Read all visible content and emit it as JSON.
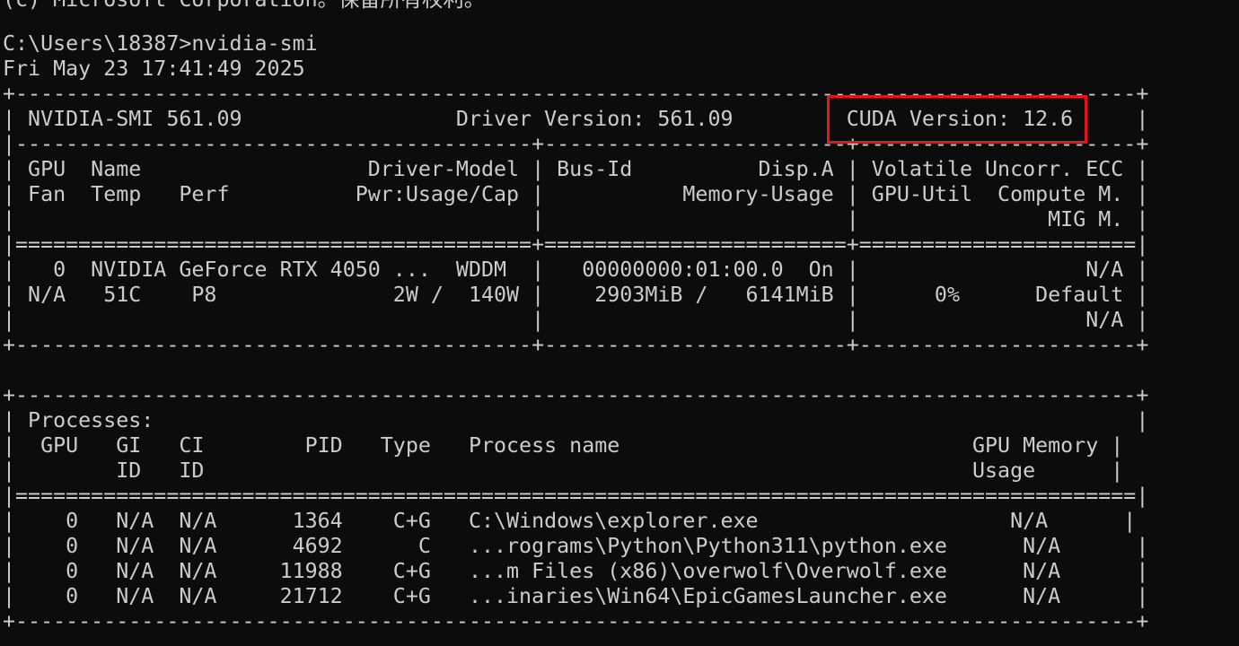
{
  "terminal": {
    "copyright_line": "(c) Microsoft Corporation。保留所有权利。",
    "prompt_line": "C:\\Users\\18387>nvidia-smi",
    "timestamp_line": "Fri May 23 17:41:49 2025",
    "gpu_table_lines": [
      "+-----------------------------------------------------------------------------------------+",
      "| NVIDIA-SMI 561.09                 Driver Version: 561.09         CUDA Version: 12.6     |",
      "|-----------------------------------------+------------------------+----------------------+",
      "| GPU  Name                  Driver-Model | Bus-Id          Disp.A | Volatile Uncorr. ECC |",
      "| Fan  Temp   Perf          Pwr:Usage/Cap |           Memory-Usage | GPU-Util  Compute M. |",
      "|                                         |                        |               MIG M. |",
      "|=========================================+========================+======================|",
      "|   0  NVIDIA GeForce RTX 4050 ...  WDDM  |   00000000:01:00.0  On |                  N/A |",
      "| N/A   51C    P8              2W /  140W |    2903MiB /   6141MiB |      0%      Default |",
      "|                                         |                        |                  N/A |",
      "+-----------------------------------------+------------------------+----------------------+"
    ],
    "process_table_lines": [
      "+-----------------------------------------------------------------------------------------+",
      "| Processes:                                                                              |",
      "|  GPU   GI   CI        PID   Type   Process name                            GPU Memory |",
      "|        ID   ID                                                             Usage      |",
      "|=========================================================================================|",
      "|    0   N/A  N/A      1364    C+G   C:\\Windows\\explorer.exe                    N/A      |",
      "|    0   N/A  N/A      4692      C   ...rograms\\Python\\Python311\\python.exe      N/A      |",
      "|    0   N/A  N/A     11988    C+G   ...m Files (x86)\\overwolf\\Overwolf.exe      N/A      |",
      "|    0   N/A  N/A     21712    C+G   ...inaries\\Win64\\EpicGamesLauncher.exe      N/A      |",
      "+-----------------------------------------------------------------------------------------+"
    ],
    "colors": {
      "background": "#0c0c0c",
      "text": "#cccccc",
      "highlight_box": "#e8141b"
    }
  }
}
